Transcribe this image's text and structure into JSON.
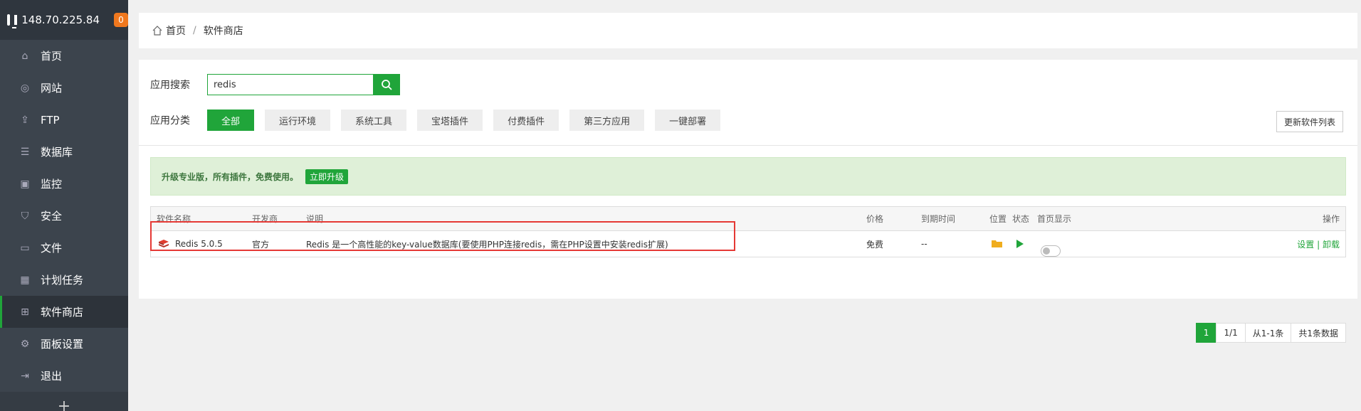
{
  "sidebar": {
    "ip": "148.70.225.84",
    "badge": "0",
    "items": [
      {
        "label": "首页",
        "icon": "home-icon"
      },
      {
        "label": "网站",
        "icon": "globe-icon"
      },
      {
        "label": "FTP",
        "icon": "ftp-icon"
      },
      {
        "label": "数据库",
        "icon": "database-icon"
      },
      {
        "label": "监控",
        "icon": "monitor-icon"
      },
      {
        "label": "安全",
        "icon": "shield-icon"
      },
      {
        "label": "文件",
        "icon": "folder-icon"
      },
      {
        "label": "计划任务",
        "icon": "calendar-icon"
      },
      {
        "label": "软件商店",
        "icon": "apps-icon"
      },
      {
        "label": "面板设置",
        "icon": "gear-icon"
      },
      {
        "label": "退出",
        "icon": "logout-icon"
      }
    ],
    "add": "+"
  },
  "breadcrumb": {
    "home": "首页",
    "separator": "/",
    "current": "软件商店"
  },
  "search": {
    "label": "应用搜索",
    "value": "redis"
  },
  "categories": {
    "label": "应用分类",
    "items": [
      "全部",
      "运行环境",
      "系统工具",
      "宝塔插件",
      "付费插件",
      "第三方应用",
      "一键部署"
    ],
    "refresh": "更新软件列表"
  },
  "notice": {
    "text": "升级专业版，所有插件，免费使用。",
    "button": "立即升级"
  },
  "table": {
    "headers": [
      "软件名称",
      "开发商",
      "说明",
      "价格",
      "到期时间",
      "位置",
      "状态",
      "首页显示",
      "操作"
    ],
    "rows": [
      {
        "name": "Redis 5.0.5",
        "developer": "官方",
        "desc": "Redis 是一个高性能的key-value数据库(要使用PHP连接redis，需在PHP设置中安装redis扩展)",
        "price": "免费",
        "expire": "--",
        "op_settings": "设置",
        "op_sep": "|",
        "op_uninstall": "卸载"
      }
    ]
  },
  "pager": {
    "current": "1",
    "pages": "1/1",
    "range": "从1-1条",
    "total": "共1条数据"
  },
  "colors": {
    "accent": "#20a53a",
    "sidebar": "#3c444d",
    "highlight": "#e53935"
  }
}
